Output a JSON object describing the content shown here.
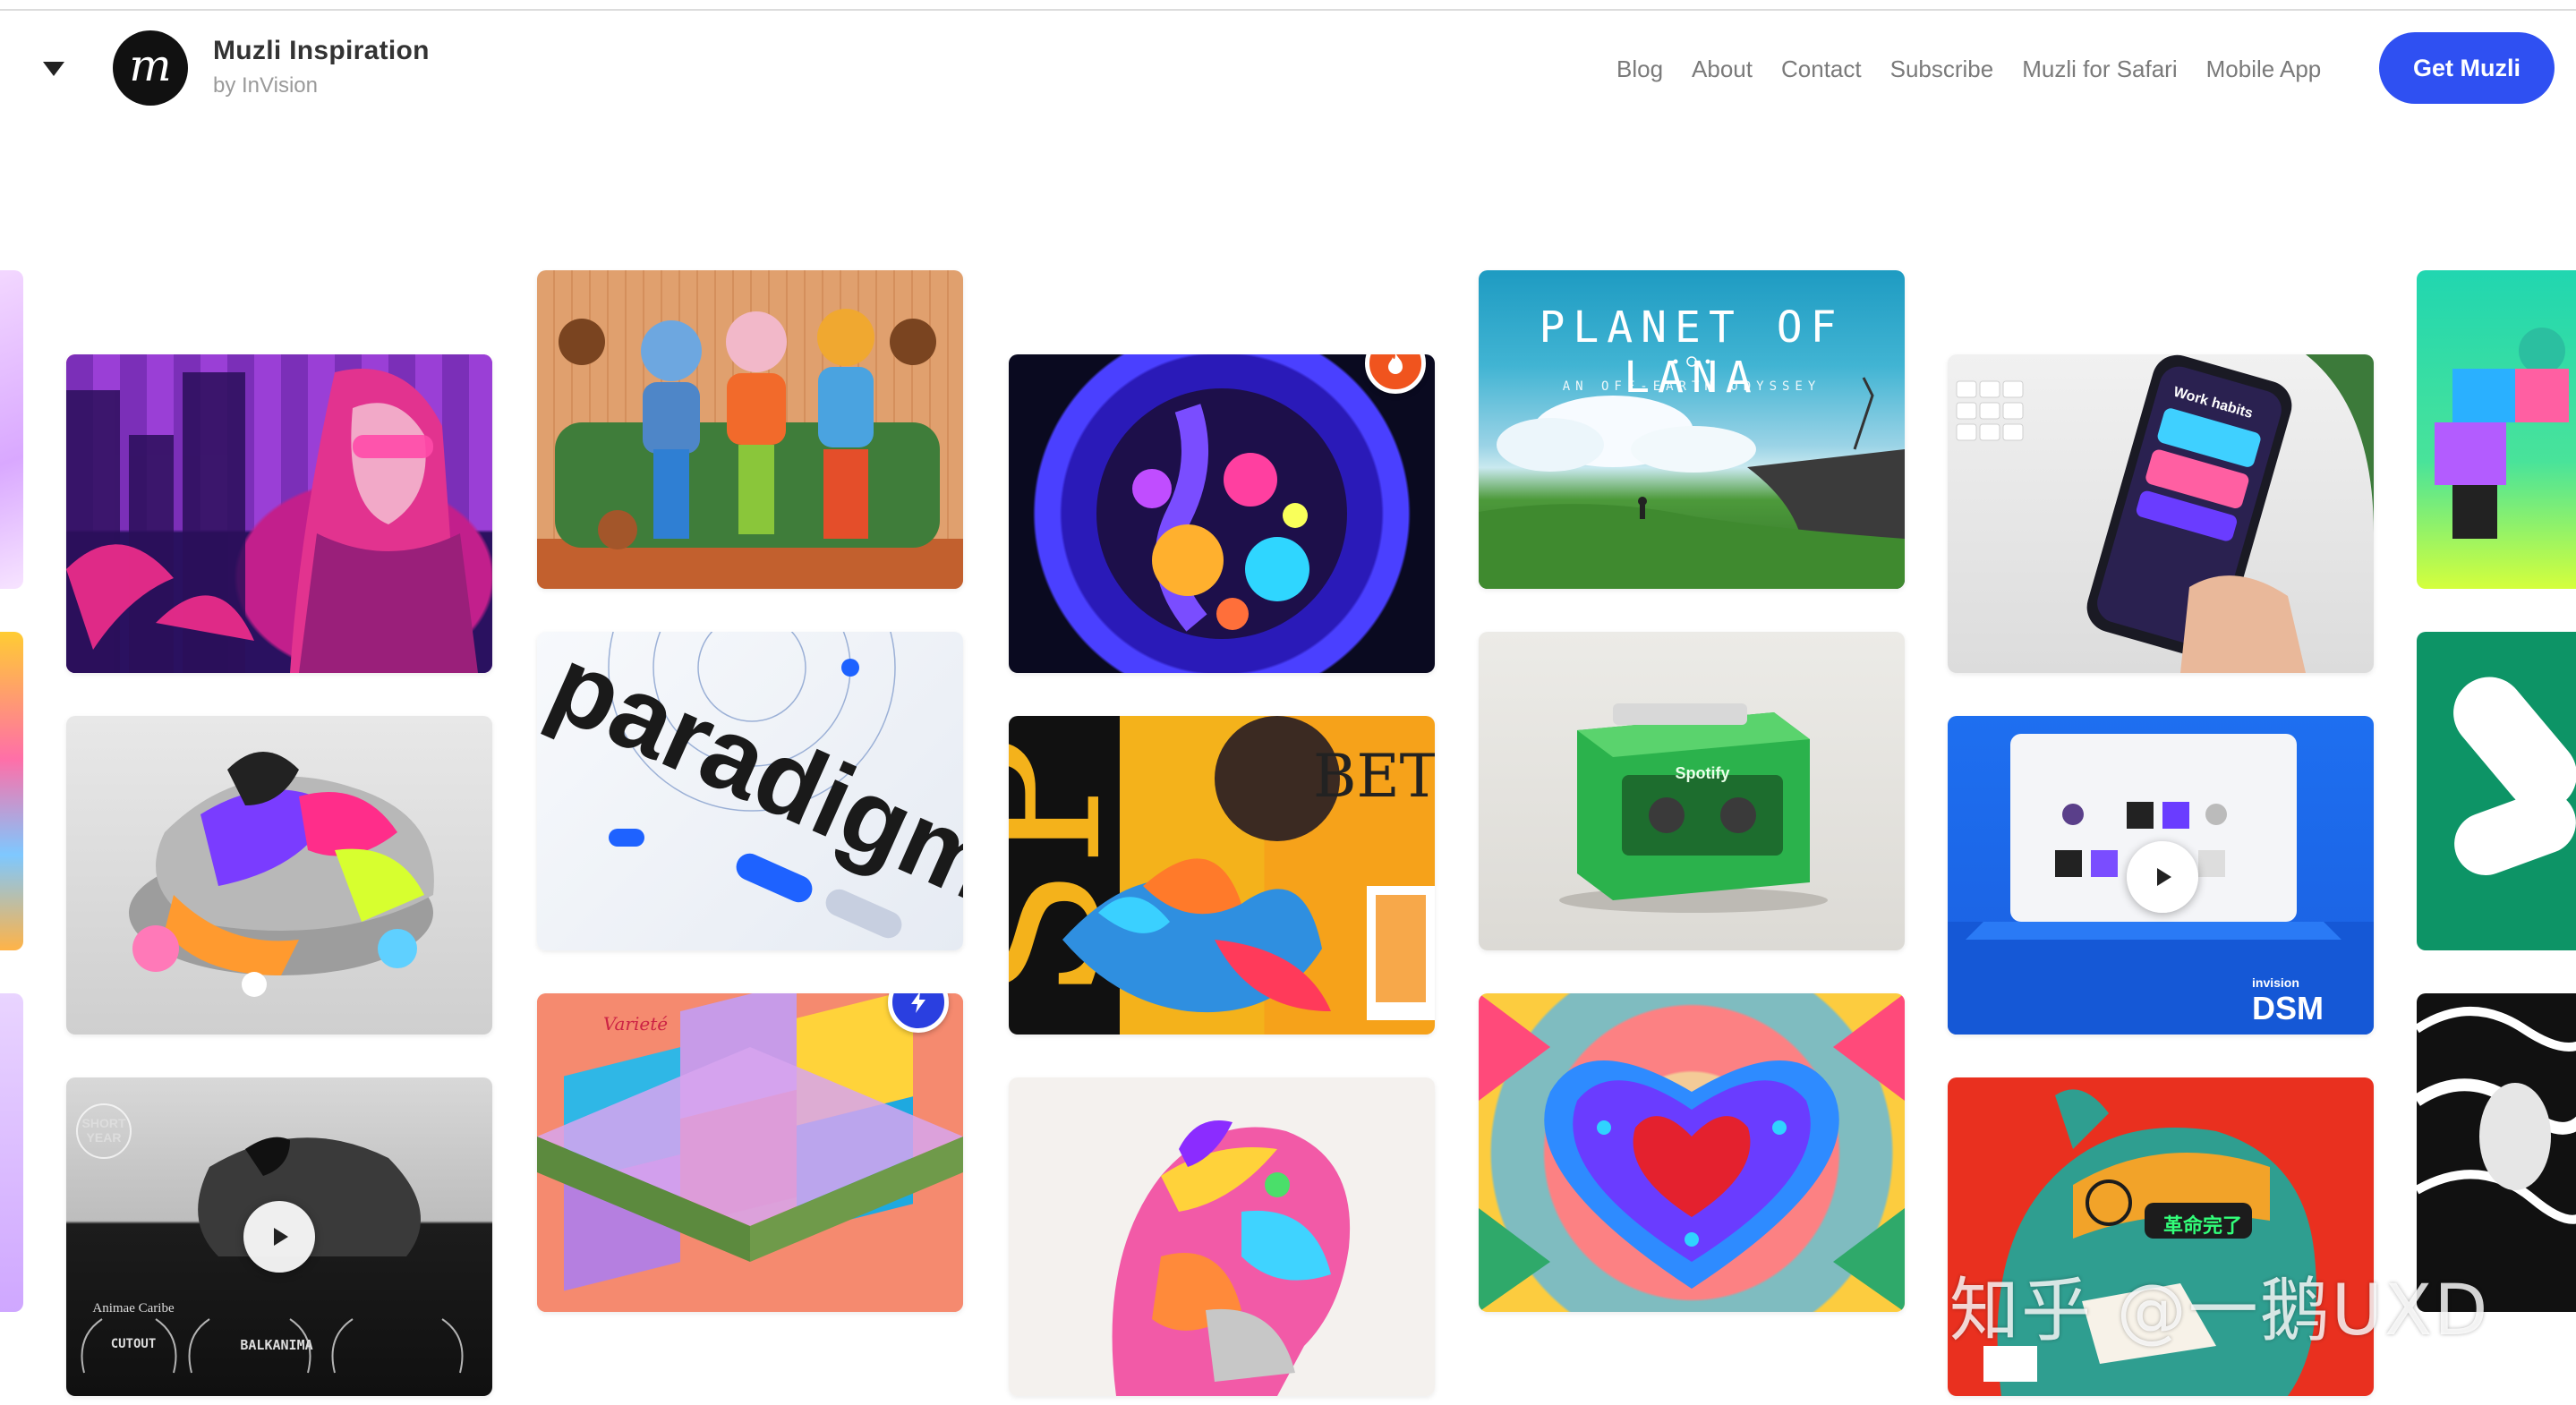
{
  "header": {
    "brand_name": "Muzli Inspiration",
    "brand_sub": "by InVision",
    "logo_letter": "m",
    "nav": [
      "Blog",
      "About",
      "Contact",
      "Subscribe",
      "Muzli for Safari",
      "Mobile App"
    ],
    "cta_label": "Get Muzli"
  },
  "tiles": {
    "lana_title": "PLANET OF LANA",
    "lana_subtitle": "AN OFF-EARTH ODYSSEY",
    "spotify_label": "Spotify",
    "dsm_brand": "invision",
    "dsm_label": "DSM",
    "paradigm_text": "paradigm",
    "variete_text": "Varieté",
    "work_habits": "Work habits",
    "poster_text": "BETTE COTTO TAIF",
    "film_laurel_1": "Animae Caribe",
    "film_laurel_2": "CUTOUT",
    "film_laurel_3": "BALKANIMA",
    "chinese_sign": "革命完了"
  },
  "watermark": "知乎 @一鹅UXD",
  "colors": {
    "accent": "#2f50f2",
    "hot_badge": "#f0541e",
    "boost_badge": "#2a3fe0"
  }
}
